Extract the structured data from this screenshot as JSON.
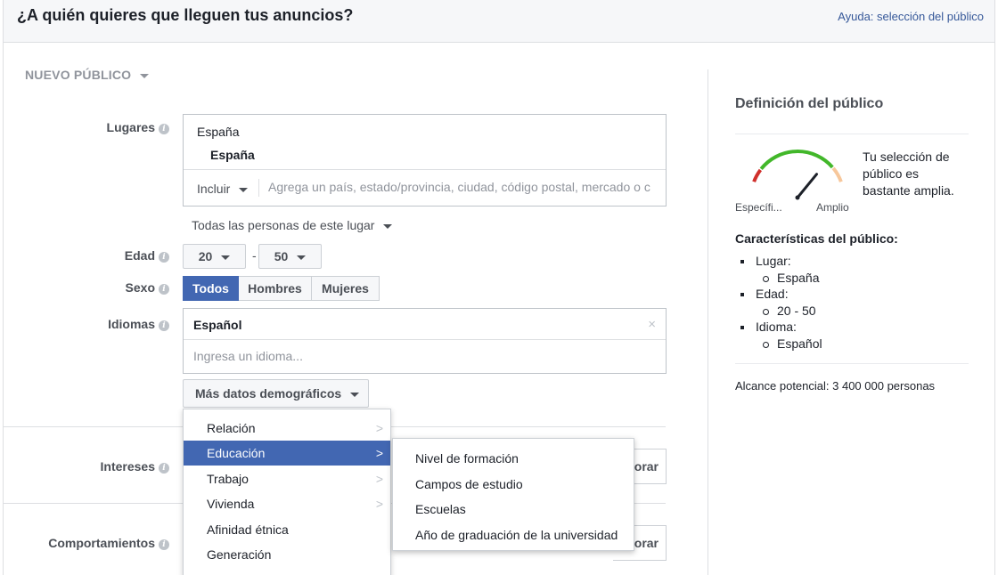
{
  "header": {
    "title": "¿A quién quieres que lleguen tus anuncios?",
    "help_link": "Ayuda: selección del público"
  },
  "audience": {
    "toggle_label": "NUEVO PÚBLICO"
  },
  "locations": {
    "label": "Lugares",
    "country": "España",
    "selected": "España",
    "include_label": "Incluir",
    "placeholder": "Agrega un país, estado/provincia, ciudad, código postal, mercado o c",
    "everyone_option": "Todas las personas de este lugar"
  },
  "age": {
    "label": "Edad",
    "min": "20",
    "max": "50",
    "separator": "-"
  },
  "gender": {
    "label": "Sexo",
    "options": [
      "Todos",
      "Hombres",
      "Mujeres"
    ],
    "selected": "Todos"
  },
  "languages": {
    "label": "Idiomas",
    "selected": "Español",
    "clear_glyph": "×",
    "placeholder": "Ingresa un idioma..."
  },
  "more_demographics": {
    "label": "Más datos demográficos"
  },
  "interests": {
    "label": "Intereses",
    "button_partial": "orar"
  },
  "behaviors": {
    "label": "Comportamientos",
    "button_partial": "orar"
  },
  "demographics_menu": {
    "items": [
      "Relación",
      "Educación",
      "Trabajo",
      "Vivienda",
      "Afinidad étnica",
      "Generación"
    ],
    "active": "Educación"
  },
  "education_submenu": {
    "items": [
      "Nivel de formación",
      "Campos de estudio",
      "Escuelas",
      "Año de graduación de la universidad"
    ]
  },
  "sidebar": {
    "title": "Definición del público",
    "gauge": {
      "description": "Tu selección de público es bastante amplia.",
      "left_label": "Específi...",
      "right_label": "Amplio",
      "level": 0.78,
      "colors": {
        "narrow": "#d0302c",
        "good": "#42b72a",
        "broad": "#f7c79b",
        "needle": "#1d2129"
      }
    },
    "characteristics_title": "Características del público:",
    "characteristics": [
      {
        "key": "Lugar:",
        "value": "España"
      },
      {
        "key": "Edad:",
        "value": "20 - 50"
      },
      {
        "key": "Idioma:",
        "value": "Español"
      }
    ],
    "reach": "Alcance potencial: 3 400 000 personas"
  },
  "colors": {
    "accent": "#4267b2",
    "link": "#365899"
  }
}
